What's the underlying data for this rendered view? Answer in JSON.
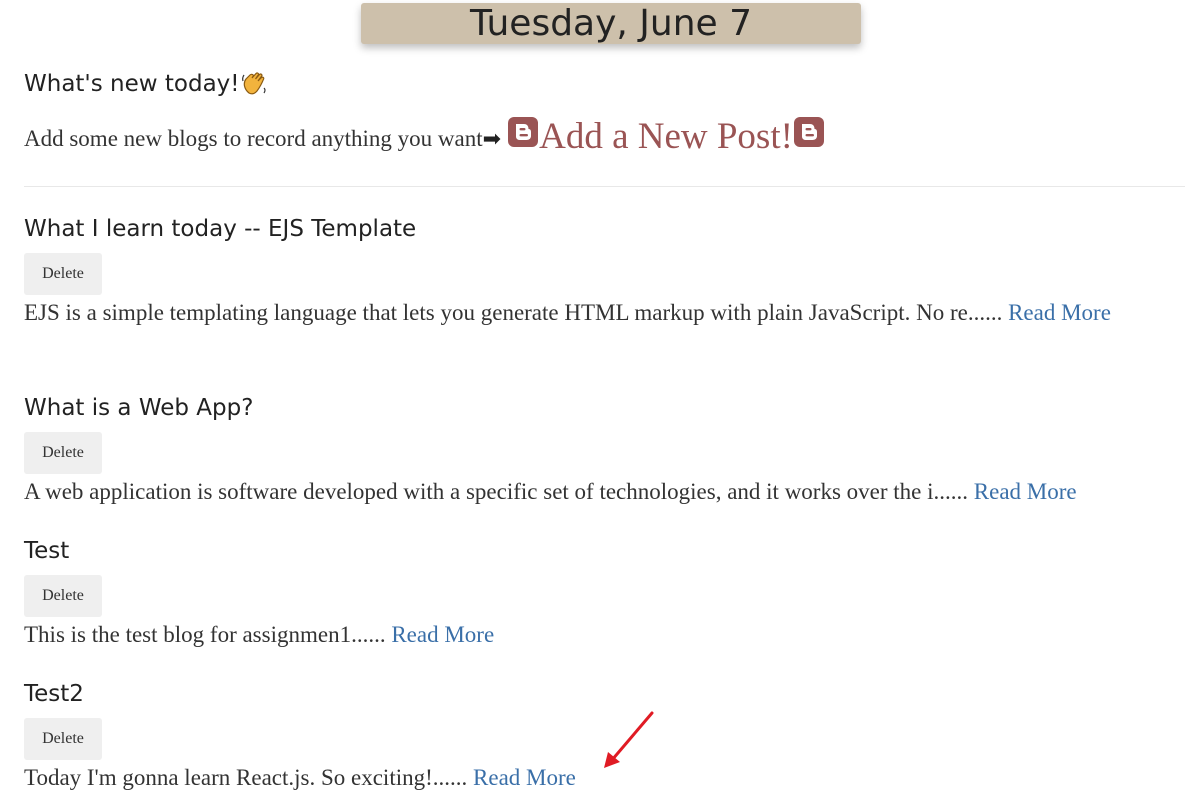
{
  "header": {
    "date": "Tuesday, June 7"
  },
  "intro": {
    "whats_new": "What's new today!",
    "add_text": "Add some new blogs to record anything you want",
    "add_link": "Add a New Post!",
    "icons": [
      "waving-hand-icon",
      "right-arrow-icon",
      "blogger-icon"
    ]
  },
  "posts": [
    {
      "title": "What I learn today -- EJS Template",
      "delete_label": "Delete",
      "excerpt": "EJS is a simple templating language that lets you generate HTML markup with plain JavaScript. No re......",
      "read_more": "Read More"
    },
    {
      "title": "What is a Web App?",
      "delete_label": "Delete",
      "excerpt": "A web application is software developed with a specific set of technologies, and it works over the i......",
      "read_more": "Read More"
    },
    {
      "title": "Test",
      "delete_label": "Delete",
      "excerpt": "This is the test blog for assignmen1......",
      "read_more": "Read More"
    },
    {
      "title": "Test2",
      "delete_label": "Delete",
      "excerpt": "Today I'm gonna learn React.js. So exciting!......",
      "read_more": "Read More"
    }
  ],
  "colors": {
    "banner_bg": "#cdc0ab",
    "link": "#3a6fa8",
    "add_link": "#9a5454",
    "annotation_arrow": "#e01b24"
  }
}
